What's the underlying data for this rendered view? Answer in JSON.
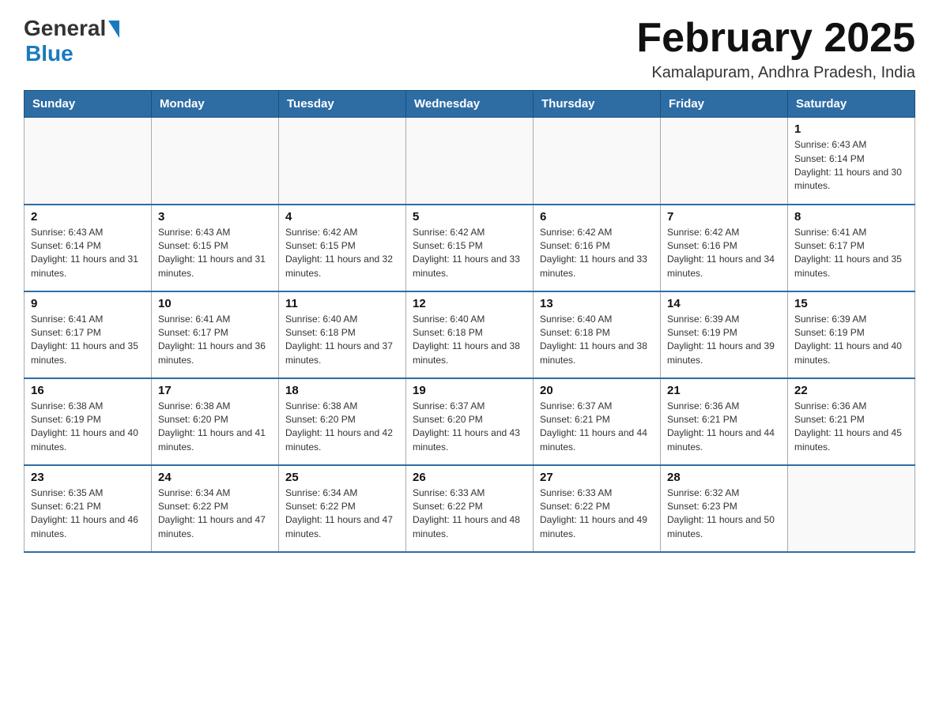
{
  "header": {
    "logo_general": "General",
    "logo_blue": "Blue",
    "title": "February 2025",
    "location": "Kamalapuram, Andhra Pradesh, India"
  },
  "weekdays": [
    "Sunday",
    "Monday",
    "Tuesday",
    "Wednesday",
    "Thursday",
    "Friday",
    "Saturday"
  ],
  "weeks": [
    [
      {
        "day": "",
        "info": ""
      },
      {
        "day": "",
        "info": ""
      },
      {
        "day": "",
        "info": ""
      },
      {
        "day": "",
        "info": ""
      },
      {
        "day": "",
        "info": ""
      },
      {
        "day": "",
        "info": ""
      },
      {
        "day": "1",
        "info": "Sunrise: 6:43 AM\nSunset: 6:14 PM\nDaylight: 11 hours and 30 minutes."
      }
    ],
    [
      {
        "day": "2",
        "info": "Sunrise: 6:43 AM\nSunset: 6:14 PM\nDaylight: 11 hours and 31 minutes."
      },
      {
        "day": "3",
        "info": "Sunrise: 6:43 AM\nSunset: 6:15 PM\nDaylight: 11 hours and 31 minutes."
      },
      {
        "day": "4",
        "info": "Sunrise: 6:42 AM\nSunset: 6:15 PM\nDaylight: 11 hours and 32 minutes."
      },
      {
        "day": "5",
        "info": "Sunrise: 6:42 AM\nSunset: 6:15 PM\nDaylight: 11 hours and 33 minutes."
      },
      {
        "day": "6",
        "info": "Sunrise: 6:42 AM\nSunset: 6:16 PM\nDaylight: 11 hours and 33 minutes."
      },
      {
        "day": "7",
        "info": "Sunrise: 6:42 AM\nSunset: 6:16 PM\nDaylight: 11 hours and 34 minutes."
      },
      {
        "day": "8",
        "info": "Sunrise: 6:41 AM\nSunset: 6:17 PM\nDaylight: 11 hours and 35 minutes."
      }
    ],
    [
      {
        "day": "9",
        "info": "Sunrise: 6:41 AM\nSunset: 6:17 PM\nDaylight: 11 hours and 35 minutes."
      },
      {
        "day": "10",
        "info": "Sunrise: 6:41 AM\nSunset: 6:17 PM\nDaylight: 11 hours and 36 minutes."
      },
      {
        "day": "11",
        "info": "Sunrise: 6:40 AM\nSunset: 6:18 PM\nDaylight: 11 hours and 37 minutes."
      },
      {
        "day": "12",
        "info": "Sunrise: 6:40 AM\nSunset: 6:18 PM\nDaylight: 11 hours and 38 minutes."
      },
      {
        "day": "13",
        "info": "Sunrise: 6:40 AM\nSunset: 6:18 PM\nDaylight: 11 hours and 38 minutes."
      },
      {
        "day": "14",
        "info": "Sunrise: 6:39 AM\nSunset: 6:19 PM\nDaylight: 11 hours and 39 minutes."
      },
      {
        "day": "15",
        "info": "Sunrise: 6:39 AM\nSunset: 6:19 PM\nDaylight: 11 hours and 40 minutes."
      }
    ],
    [
      {
        "day": "16",
        "info": "Sunrise: 6:38 AM\nSunset: 6:19 PM\nDaylight: 11 hours and 40 minutes."
      },
      {
        "day": "17",
        "info": "Sunrise: 6:38 AM\nSunset: 6:20 PM\nDaylight: 11 hours and 41 minutes."
      },
      {
        "day": "18",
        "info": "Sunrise: 6:38 AM\nSunset: 6:20 PM\nDaylight: 11 hours and 42 minutes."
      },
      {
        "day": "19",
        "info": "Sunrise: 6:37 AM\nSunset: 6:20 PM\nDaylight: 11 hours and 43 minutes."
      },
      {
        "day": "20",
        "info": "Sunrise: 6:37 AM\nSunset: 6:21 PM\nDaylight: 11 hours and 44 minutes."
      },
      {
        "day": "21",
        "info": "Sunrise: 6:36 AM\nSunset: 6:21 PM\nDaylight: 11 hours and 44 minutes."
      },
      {
        "day": "22",
        "info": "Sunrise: 6:36 AM\nSunset: 6:21 PM\nDaylight: 11 hours and 45 minutes."
      }
    ],
    [
      {
        "day": "23",
        "info": "Sunrise: 6:35 AM\nSunset: 6:21 PM\nDaylight: 11 hours and 46 minutes."
      },
      {
        "day": "24",
        "info": "Sunrise: 6:34 AM\nSunset: 6:22 PM\nDaylight: 11 hours and 47 minutes."
      },
      {
        "day": "25",
        "info": "Sunrise: 6:34 AM\nSunset: 6:22 PM\nDaylight: 11 hours and 47 minutes."
      },
      {
        "day": "26",
        "info": "Sunrise: 6:33 AM\nSunset: 6:22 PM\nDaylight: 11 hours and 48 minutes."
      },
      {
        "day": "27",
        "info": "Sunrise: 6:33 AM\nSunset: 6:22 PM\nDaylight: 11 hours and 49 minutes."
      },
      {
        "day": "28",
        "info": "Sunrise: 6:32 AM\nSunset: 6:23 PM\nDaylight: 11 hours and 50 minutes."
      },
      {
        "day": "",
        "info": ""
      }
    ]
  ]
}
